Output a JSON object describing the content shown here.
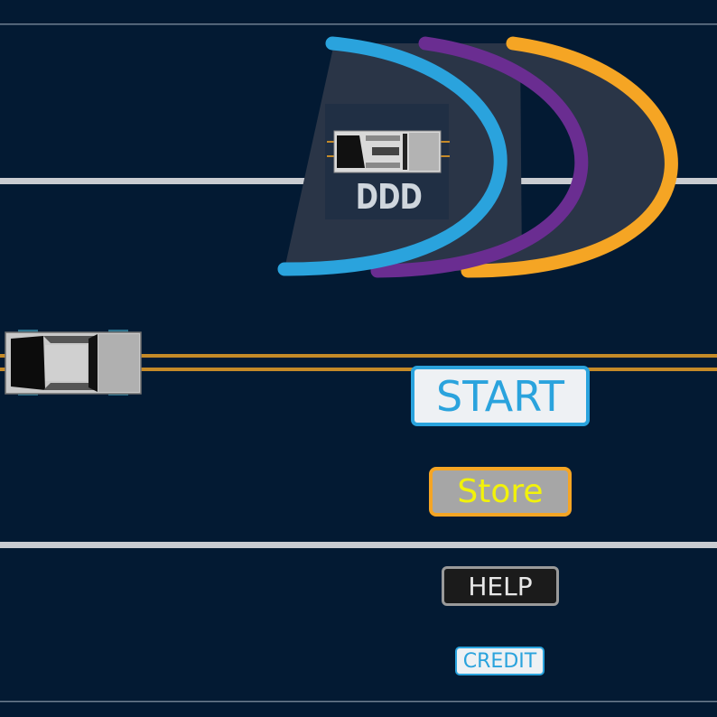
{
  "logo": {
    "text": "DDD"
  },
  "menu": {
    "start_label": "START",
    "store_label": "Store",
    "help_label": "HELP",
    "credit_label": "CREDIT"
  },
  "colors": {
    "background": "#031a33",
    "arc_blue": "#2aa3dd",
    "arc_purple": "#6a2d91",
    "arc_orange": "#f5a524",
    "lane_white": "#c9ccd1",
    "lane_yellow": "#c58a28"
  }
}
